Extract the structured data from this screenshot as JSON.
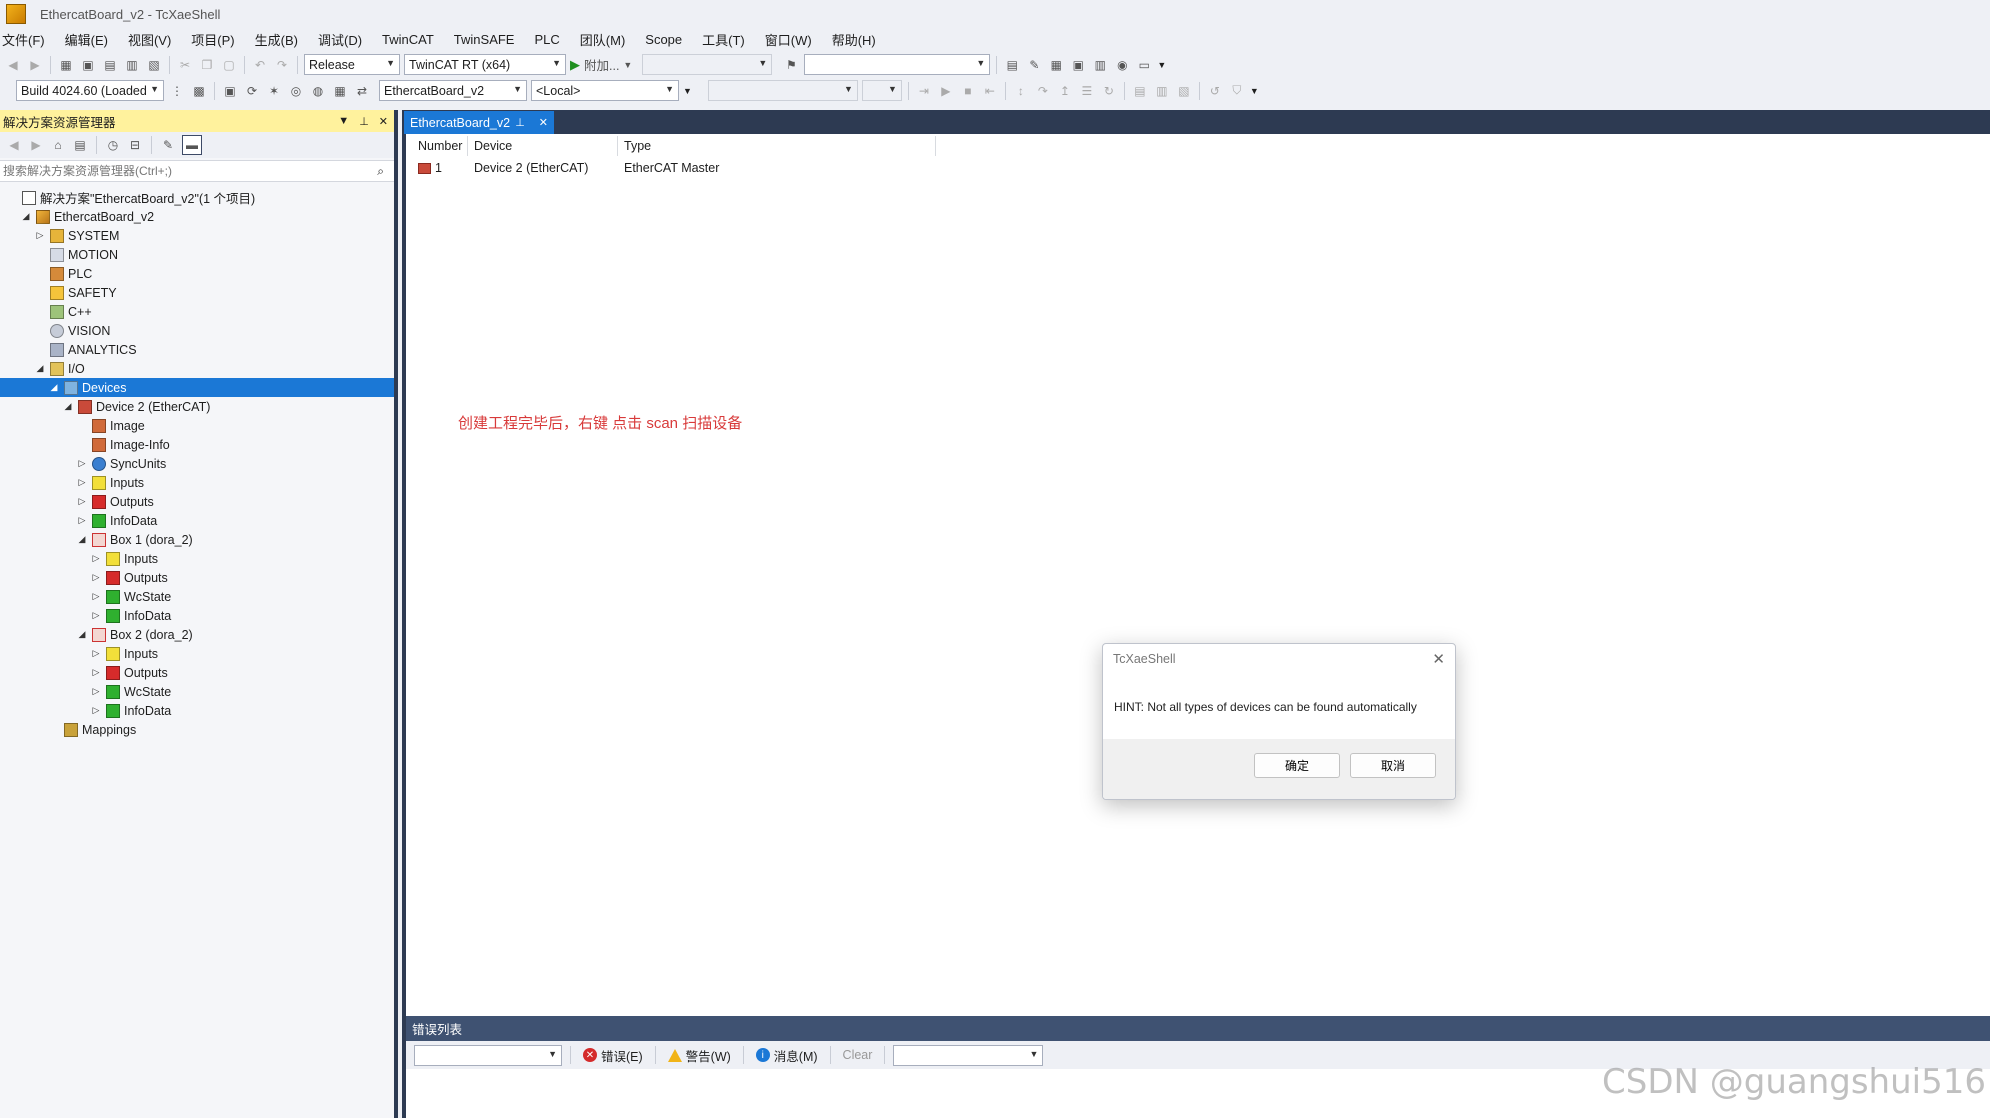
{
  "window": {
    "title": "EthercatBoard_v2 - TcXaeShell"
  },
  "menu": [
    "文件(F)",
    "编辑(E)",
    "视图(V)",
    "项目(P)",
    "生成(B)",
    "调试(D)",
    "TwinCAT",
    "TwinSAFE",
    "PLC",
    "团队(M)",
    "Scope",
    "工具(T)",
    "窗口(W)",
    "帮助(H)"
  ],
  "toolbar1": {
    "config": "Release",
    "platform": "TwinCAT RT (x64)",
    "attach_label": "附加...",
    "search_value": ""
  },
  "toolbar2": {
    "build": "Build 4024.60 (Loaded",
    "project": "EthercatBoard_v2",
    "target": "<Local>"
  },
  "solution_explorer": {
    "title": "解决方案资源管理器",
    "search_placeholder": "搜索解决方案资源管理器(Ctrl+;)",
    "tree": [
      {
        "label": "解决方案\"EthercatBoard_v2\"(1 个项目)",
        "icon": "solution-icon",
        "indent": 0,
        "exp": ""
      },
      {
        "label": "EthercatBoard_v2",
        "icon": "project-icon",
        "indent": 1,
        "exp": "open"
      },
      {
        "label": "SYSTEM",
        "icon": "system-icon",
        "indent": 2,
        "exp": "closed"
      },
      {
        "label": "MOTION",
        "icon": "motion-icon",
        "indent": 2,
        "exp": ""
      },
      {
        "label": "PLC",
        "icon": "plc-icon",
        "indent": 2,
        "exp": ""
      },
      {
        "label": "SAFETY",
        "icon": "safety-icon",
        "indent": 2,
        "exp": ""
      },
      {
        "label": "C++",
        "icon": "cpp-icon",
        "indent": 2,
        "exp": ""
      },
      {
        "label": "VISION",
        "icon": "vision-icon",
        "indent": 2,
        "exp": ""
      },
      {
        "label": "ANALYTICS",
        "icon": "analytics-icon",
        "indent": 2,
        "exp": ""
      },
      {
        "label": "I/O",
        "icon": "io-icon",
        "indent": 2,
        "exp": "open"
      },
      {
        "label": "Devices",
        "icon": "devices-icon",
        "indent": 3,
        "exp": "open",
        "selected": true
      },
      {
        "label": "Device 2 (EtherCAT)",
        "icon": "ethercat-device-icon",
        "indent": 4,
        "exp": "open"
      },
      {
        "label": "Image",
        "icon": "image-icon",
        "indent": 5,
        "exp": ""
      },
      {
        "label": "Image-Info",
        "icon": "image-icon",
        "indent": 5,
        "exp": ""
      },
      {
        "label": "SyncUnits",
        "icon": "sync-icon",
        "indent": 5,
        "exp": "closed"
      },
      {
        "label": "Inputs",
        "icon": "inputs-icon",
        "indent": 5,
        "exp": "closed"
      },
      {
        "label": "Outputs",
        "icon": "outputs-icon",
        "indent": 5,
        "exp": "closed"
      },
      {
        "label": "InfoData",
        "icon": "infodata-icon",
        "indent": 5,
        "exp": "closed"
      },
      {
        "label": "Box 1 (dora_2)",
        "icon": "box-icon",
        "indent": 5,
        "exp": "open"
      },
      {
        "label": "Inputs",
        "icon": "inputs-icon",
        "indent": 6,
        "exp": "closed"
      },
      {
        "label": "Outputs",
        "icon": "outputs-icon",
        "indent": 6,
        "exp": "closed"
      },
      {
        "label": "WcState",
        "icon": "infodata-icon",
        "indent": 6,
        "exp": "closed"
      },
      {
        "label": "InfoData",
        "icon": "infodata-icon",
        "indent": 6,
        "exp": "closed"
      },
      {
        "label": "Box 2 (dora_2)",
        "icon": "box-icon",
        "indent": 5,
        "exp": "open"
      },
      {
        "label": "Inputs",
        "icon": "inputs-icon",
        "indent": 6,
        "exp": "closed"
      },
      {
        "label": "Outputs",
        "icon": "outputs-icon",
        "indent": 6,
        "exp": "closed"
      },
      {
        "label": "WcState",
        "icon": "infodata-icon",
        "indent": 6,
        "exp": "closed"
      },
      {
        "label": "InfoData",
        "icon": "infodata-icon",
        "indent": 6,
        "exp": "closed"
      },
      {
        "label": "Mappings",
        "icon": "mappings-icon",
        "indent": 3,
        "exp": ""
      }
    ]
  },
  "document": {
    "tab": "EthercatBoard_v2",
    "columns": [
      "Number",
      "Device",
      "Type"
    ],
    "rows": [
      {
        "number": "1",
        "device": "Device 2 (EtherCAT)",
        "type": "EtherCAT Master"
      }
    ],
    "annotation": "创建工程完毕后，右键 点击 scan 扫描设备"
  },
  "dialog": {
    "title": "TcXaeShell",
    "message": "HINT: Not all types of devices can be found automatically",
    "ok": "确定",
    "cancel": "取消"
  },
  "error_list": {
    "title": "错误列表",
    "errors": "错误(E)",
    "warnings": "警告(W)",
    "messages": "消息(M)",
    "clear": "Clear"
  },
  "watermark": "CSDN @guangshui516",
  "colors": {
    "accent": "#1b78d6",
    "dark_frame": "#2d3a52",
    "panel_header": "#fff29d",
    "annotation": "#d83a3a"
  }
}
